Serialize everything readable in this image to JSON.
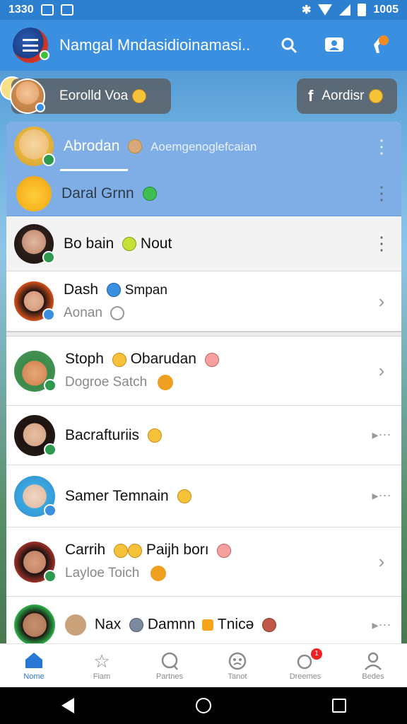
{
  "status_bar": {
    "time": "1330",
    "right_time": "1005"
  },
  "app_bar": {
    "title": "Namgal Mndasidioinamasi..",
    "icons": [
      "search-icon",
      "contacts-icon",
      "notification-icon"
    ]
  },
  "pills": {
    "left_label": "Eorolld Voa",
    "right_label": "Aordisr",
    "right_icon": "f"
  },
  "list": {
    "rows": [
      {
        "name": "Abrodan",
        "extra": "Aoemgenoglefcaian",
        "action": "⋮"
      },
      {
        "name": "Daral Grnn",
        "action": "⋮"
      },
      {
        "name": "Bo bain",
        "extra": "Nout",
        "action": "⋮"
      },
      {
        "name": "Dash",
        "extra": "Smpan",
        "sub": "Aonan",
        "action": "›"
      },
      {
        "name": "Stoph",
        "extra": "Obarudan",
        "sub": "Dogroe Satch",
        "action": "›"
      },
      {
        "name": "Bacrafturiis",
        "action": "▸⋯"
      },
      {
        "name": "Samer Temnain",
        "action": "▸⋯"
      },
      {
        "name": "Carrih",
        "extra": "Paijh borı",
        "sub": "Layloe Toich",
        "action": "›"
      },
      {
        "name": "Nax",
        "extra": "Damnn",
        "extra2": "Tnicə",
        "action": "▸⋯"
      }
    ]
  },
  "bottom_nav": {
    "items": [
      {
        "label": "Nome",
        "icon": "home-icon"
      },
      {
        "label": "Fiam",
        "icon": "star-icon"
      },
      {
        "label": "Partnes",
        "icon": "chat-icon"
      },
      {
        "label": "Tanot",
        "icon": "face-icon"
      },
      {
        "label": "Dreemes",
        "icon": "bubble-icon",
        "badge": "1"
      },
      {
        "label": "Bedes",
        "icon": "profile-icon"
      }
    ]
  },
  "colors": {
    "accent": "#2a78d6",
    "app_bar": "#3a8fe0",
    "highlight_row": "#7faee6"
  }
}
